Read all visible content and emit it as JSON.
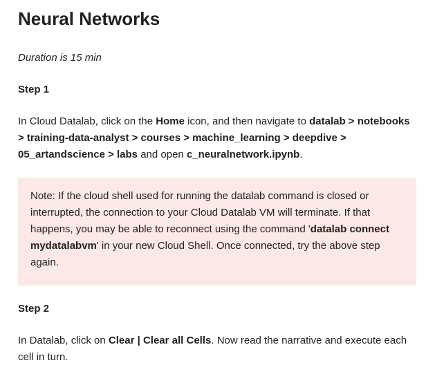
{
  "page": {
    "title": "Neural Networks",
    "duration": "Duration is 15 min"
  },
  "step1": {
    "heading": "Step 1",
    "text_1": "In Cloud Datalab, click on the ",
    "home": "Home",
    "text_2": " icon, and then navigate to ",
    "path": "datalab > notebooks > training-data-analyst > courses > machine_learning > deepdive > 05_artandscience > labs",
    "text_3": " and open ",
    "file": "c_neuralnetwork.ipynb",
    "text_4": "."
  },
  "note": {
    "text_1": "Note: If the cloud shell used for running the datalab command is closed or interrupted, the connection to your Cloud Datalab VM will terminate. If that happens, you may be able to reconnect using the command '",
    "command": "datalab connect mydatalabvm",
    "text_2": "' in your new Cloud Shell. Once connected, try the above step again."
  },
  "step2": {
    "heading": "Step 2",
    "text_1": "In Datalab, click on ",
    "clear": "Clear | Clear all Cells",
    "text_2": ". Now read the narrative and execute each cell in turn."
  },
  "colors": {
    "note_background": "#fce8e6",
    "text": "#202124"
  }
}
